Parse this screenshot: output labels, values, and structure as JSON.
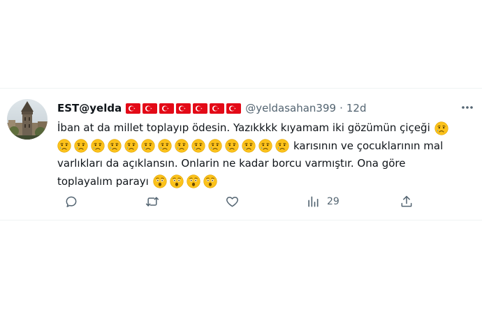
{
  "tweet": {
    "display_name": "EST@yelda",
    "handle": "@yeldasahan399",
    "separator": "·",
    "timestamp": "12d",
    "flag_count": 7,
    "text": {
      "line1": "İban at da millet toplayıp ödesin. Yazıkkkk kıyamam iki gözümün çiçeği",
      "line2_text": "karısının ve çocuklarının mal",
      "line3": "varlıkları da açıklansın. Onlarin ne kadar borcu varmıştır. Ona göre",
      "line4": "toplayalım parayı"
    },
    "emoji": {
      "crying_count_line2": 14,
      "astonished_count_line4": 4
    },
    "actions": {
      "reply_icon": "reply-icon",
      "retweet_icon": "retweet-icon",
      "like_icon": "heart-icon",
      "views_icon": "views-icon",
      "views_count": "29",
      "share_icon": "share-icon"
    },
    "colors": {
      "text": "#0f1419",
      "secondary": "#536471",
      "flag_red": "#e30a17"
    }
  }
}
